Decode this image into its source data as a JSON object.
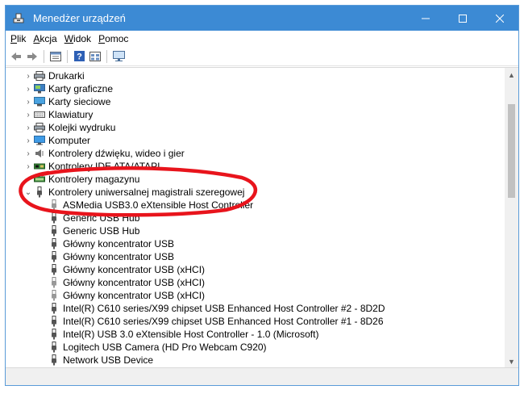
{
  "window": {
    "title": "Menedżer urządzeń",
    "controls": [
      "minimize",
      "maximize",
      "close"
    ]
  },
  "menu": [
    {
      "label": "Plik",
      "accel": "P",
      "rest": "lik"
    },
    {
      "label": "Akcja",
      "accel": "A",
      "rest": "kcja"
    },
    {
      "label": "Widok",
      "accel": "W",
      "rest": "idok"
    },
    {
      "label": "Pomoc",
      "accel": "P",
      "rest": "omoc"
    }
  ],
  "toolbar": [
    "back-icon",
    "forward-icon",
    "properties-icon",
    "help-icon",
    "view-icon",
    "monitor-icon"
  ],
  "tree": {
    "categories": [
      {
        "label": "Drukarki",
        "icon": "printer-icon"
      },
      {
        "label": "Karty graficzne",
        "icon": "display-adapter-icon"
      },
      {
        "label": "Karty sieciowe",
        "icon": "network-adapter-icon"
      },
      {
        "label": "Klawiatury",
        "icon": "keyboard-icon"
      },
      {
        "label": "Kolejki wydruku",
        "icon": "print-queue-icon"
      },
      {
        "label": "Komputer",
        "icon": "computer-icon"
      },
      {
        "label": "Kontrolery dźwięku, wideo i gier",
        "icon": "speaker-icon"
      },
      {
        "label": "Kontrolery IDE ATA/ATAPI",
        "icon": "ide-controller-icon"
      },
      {
        "label": "Kontrolery magazynu",
        "icon": "storage-controller-icon"
      }
    ],
    "usb_category": {
      "label": "Kontrolery uniwersalnej magistrali szeregowej",
      "icon": "usb-icon"
    },
    "usb_devices": [
      "ASMedia USB3.0 eXtensible Host Controller",
      "Generic USB Hub",
      "Generic USB Hub",
      "Główny koncentrator USB",
      "Główny koncentrator USB",
      "Główny koncentrator USB (xHCI)",
      "Główny koncentrator USB (xHCI)",
      "Główny koncentrator USB (xHCI)",
      "Intel(R) C610 series/X99 chipset USB Enhanced Host Controller #2 - 8D2D",
      "Intel(R) C610 series/X99 chipset USB Enhanced Host Controller #1 - 8D26",
      "Intel(R) USB 3.0 eXtensible Host Controller - 1.0 (Microsoft)",
      "Logitech USB Camera (HD Pro Webcam C920)",
      "Network USB Device"
    ]
  },
  "colors": {
    "titlebar": "#3c8ad4",
    "annotation": "#e8141c"
  }
}
